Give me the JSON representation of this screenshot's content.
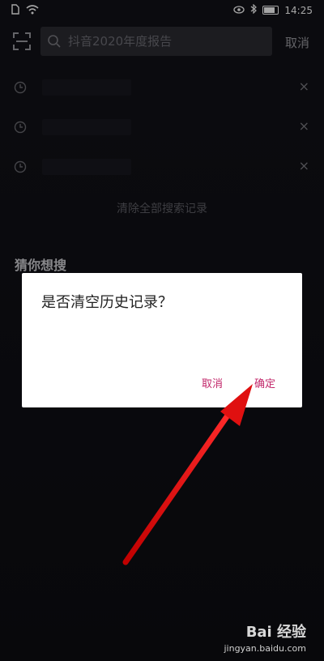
{
  "status_bar": {
    "time": "14:25"
  },
  "search": {
    "placeholder": "抖音2020年度报告",
    "cancel_label": "取消"
  },
  "history": {
    "clear_all_label": "清除全部搜索记录",
    "close_glyph": "×"
  },
  "guess": {
    "title": "猜你想搜"
  },
  "dialog": {
    "title": "是否清空历史记录？",
    "cancel_label": "取消",
    "confirm_label": "确定",
    "accent_color": "#c2276a"
  },
  "watermark": {
    "brand": "Bai 经验",
    "url": "jingyan.baidu.com"
  },
  "annotation": {
    "arrow_color": "#e01010"
  }
}
